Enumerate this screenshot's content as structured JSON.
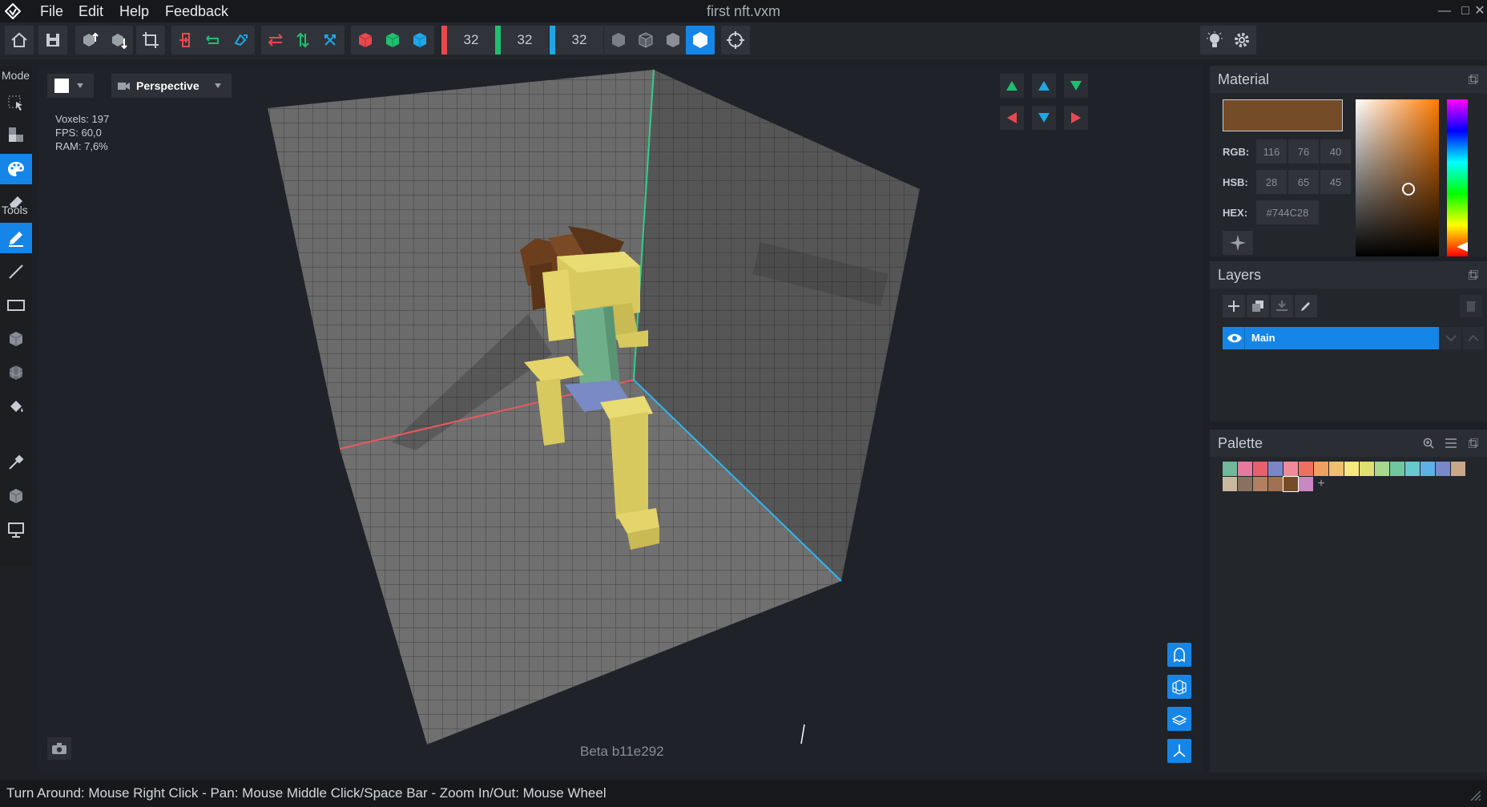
{
  "app": {
    "title": "first nft.vxm",
    "menu": [
      "File",
      "Edit",
      "Help",
      "Feedback"
    ]
  },
  "toolbar": {
    "dims": {
      "x": "32",
      "y": "32",
      "z": "32"
    },
    "colors": {
      "x": "#e8494f",
      "y": "#1fbf6f",
      "z": "#1fa6e8"
    }
  },
  "left": {
    "mode_label": "Mode",
    "tools_label": "Tools"
  },
  "viewport": {
    "camera": "Perspective",
    "stats": {
      "voxels": "Voxels: 197",
      "fps": "FPS: 60,0",
      "ram": "RAM: 7,6%"
    },
    "version": "Beta b11e292"
  },
  "material": {
    "title": "Material",
    "swatch": "#744C28",
    "rgb_label": "RGB:",
    "rgb": [
      "116",
      "76",
      "40"
    ],
    "hsb_label": "HSB:",
    "hsb": [
      "28",
      "65",
      "45"
    ],
    "hex_label": "HEX:",
    "hex": "#744C28"
  },
  "layers": {
    "title": "Layers",
    "items": [
      {
        "name": "Main"
      }
    ]
  },
  "palette": {
    "title": "Palette",
    "colors": [
      "#6fb89a",
      "#e878a0",
      "#e8606e",
      "#7a86c8",
      "#f08a9a",
      "#f07060",
      "#f0a060",
      "#f0c070",
      "#f8e880",
      "#e0e070",
      "#a8d890",
      "#70c8a0",
      "#68c8d0",
      "#60b0e8",
      "#7888c8",
      "#c8a888",
      "#c8b8a0",
      "#8a7060",
      "#b08060",
      "#a07050",
      "#744c28",
      "#c888c0"
    ]
  },
  "statusbar": {
    "hint": "Turn Around: Mouse Right Click - Pan: Mouse Middle Click/Space Bar - Zoom In/Out: Mouse Wheel"
  }
}
